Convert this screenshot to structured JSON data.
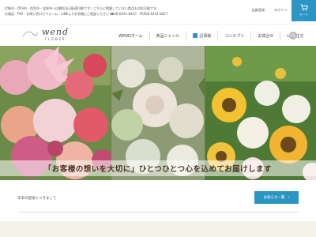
{
  "topbar": {
    "info_line1": "尼崎市・伊丹市・西宮市・宝塚市へは最短当日配達可能です！こちらに掲載していない商品も対応可能です。",
    "info_line2": "お電話・FAX・お問い合わせフォーム・LINEよりお気軽にご相談ください ☎06-6431-8410　FAX06-6431-8417",
    "links": [
      "会員登録",
      "ログイン"
    ],
    "cart_label": "カート"
  },
  "header": {
    "logo_script": "wend",
    "logo_sub": "FLOWER",
    "nav": [
      "WENDホーム",
      "商品ジャンル",
      "記事帳",
      "コンセプト",
      "お問合せ",
      "LINE注文"
    ]
  },
  "hero": {
    "tagline": "「お客様の想いを大切に」ひとつひとつ心を込めてお届けします"
  },
  "news": {
    "item": "年末の配達につきまして",
    "button_label": "お知らせ一覧",
    "button_arrow": "›"
  },
  "colors": {
    "accent": "#2b95c3",
    "tagline_text": "#4a3420"
  }
}
